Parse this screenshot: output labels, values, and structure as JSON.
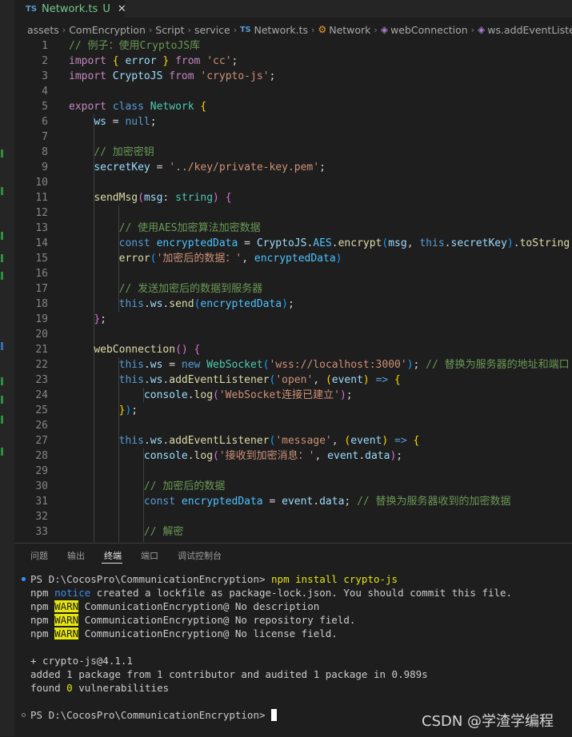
{
  "colors": {
    "comment": "#6a9955",
    "keyword": "#569cd6",
    "control": "#c586c0",
    "string": "#ce9178",
    "type": "#4ec9b0",
    "function": "#dcdcaa",
    "variable": "#9cdcfe",
    "constant": "#4fc1ff",
    "plain": "#d4d4d4",
    "bracket1": "#ffd700",
    "bracket2": "#da70d6",
    "bracket3": "#179fff"
  },
  "tab": {
    "badge": "TS",
    "title": "Network.ts",
    "status": "U",
    "close_icon": "close-icon"
  },
  "breadcrumb": {
    "items": [
      "assets",
      "ComEncryption",
      "Script",
      "service"
    ],
    "file_badge": "TS",
    "file": "Network.ts",
    "class_name": "Network",
    "method1": "webConnection",
    "method2": "ws.addEventListe"
  },
  "code_lines": [
    [
      [
        "// 例子：使用CryptoJS库",
        "comment"
      ]
    ],
    [
      [
        "import",
        "control"
      ],
      [
        " ",
        "plain"
      ],
      [
        "{",
        "bracket1"
      ],
      [
        " ",
        "plain"
      ],
      [
        "error",
        "variable"
      ],
      [
        " ",
        "plain"
      ],
      [
        "}",
        "bracket1"
      ],
      [
        " ",
        "plain"
      ],
      [
        "from",
        "control"
      ],
      [
        " ",
        "plain"
      ],
      [
        "'cc'",
        "string"
      ],
      [
        ";",
        "plain"
      ]
    ],
    [
      [
        "import",
        "control"
      ],
      [
        " ",
        "plain"
      ],
      [
        "CryptoJS",
        "variable"
      ],
      [
        " ",
        "plain"
      ],
      [
        "from",
        "control"
      ],
      [
        " ",
        "plain"
      ],
      [
        "'crypto-js'",
        "string"
      ],
      [
        ";",
        "plain"
      ]
    ],
    [],
    [
      [
        "export",
        "control"
      ],
      [
        " ",
        "plain"
      ],
      [
        "class",
        "keyword"
      ],
      [
        " ",
        "plain"
      ],
      [
        "Network",
        "type"
      ],
      [
        " ",
        "plain"
      ],
      [
        "{",
        "bracket1"
      ]
    ],
    [
      [
        "    ",
        "plain"
      ],
      [
        "ws",
        "variable"
      ],
      [
        " = ",
        "plain"
      ],
      [
        "null",
        "keyword"
      ],
      [
        ";",
        "plain"
      ]
    ],
    [],
    [
      [
        "    ",
        "plain"
      ],
      [
        "// 加密密钥",
        "comment"
      ]
    ],
    [
      [
        "    ",
        "plain"
      ],
      [
        "secretKey",
        "variable"
      ],
      [
        " = ",
        "plain"
      ],
      [
        "'../key/private-key.pem'",
        "string"
      ],
      [
        ";",
        "plain"
      ]
    ],
    [],
    [
      [
        "    ",
        "plain"
      ],
      [
        "sendMsg",
        "function"
      ],
      [
        "(",
        "bracket2"
      ],
      [
        "msg",
        "variable"
      ],
      [
        ": ",
        "plain"
      ],
      [
        "string",
        "type"
      ],
      [
        ")",
        "bracket2"
      ],
      [
        " ",
        "plain"
      ],
      [
        "{",
        "bracket2"
      ]
    ],
    [],
    [
      [
        "        ",
        "plain"
      ],
      [
        "// 使用AES加密算法加密数据",
        "comment"
      ]
    ],
    [
      [
        "        ",
        "plain"
      ],
      [
        "const",
        "keyword"
      ],
      [
        " ",
        "plain"
      ],
      [
        "encryptedData",
        "constant"
      ],
      [
        " = ",
        "plain"
      ],
      [
        "CryptoJS",
        "variable"
      ],
      [
        ".",
        "plain"
      ],
      [
        "AES",
        "constant"
      ],
      [
        ".",
        "plain"
      ],
      [
        "encrypt",
        "function"
      ],
      [
        "(",
        "bracket3"
      ],
      [
        "msg",
        "variable"
      ],
      [
        ", ",
        "plain"
      ],
      [
        "this",
        "keyword"
      ],
      [
        ".",
        "plain"
      ],
      [
        "secretKey",
        "variable"
      ],
      [
        ")",
        "bracket3"
      ],
      [
        ".",
        "plain"
      ],
      [
        "toString",
        "function"
      ],
      [
        "()",
        "bracket3"
      ]
    ],
    [
      [
        "        ",
        "plain"
      ],
      [
        "error",
        "function"
      ],
      [
        "(",
        "bracket3"
      ],
      [
        "'加密后的数据：'",
        "string"
      ],
      [
        ", ",
        "plain"
      ],
      [
        "encryptedData",
        "constant"
      ],
      [
        ")",
        "bracket3"
      ]
    ],
    [],
    [
      [
        "        ",
        "plain"
      ],
      [
        "// 发送加密后的数据到服务器",
        "comment"
      ]
    ],
    [
      [
        "        ",
        "plain"
      ],
      [
        "this",
        "keyword"
      ],
      [
        ".",
        "plain"
      ],
      [
        "ws",
        "variable"
      ],
      [
        ".",
        "plain"
      ],
      [
        "send",
        "function"
      ],
      [
        "(",
        "bracket3"
      ],
      [
        "encryptedData",
        "constant"
      ],
      [
        ")",
        "bracket3"
      ],
      [
        ";",
        "plain"
      ]
    ],
    [
      [
        "    ",
        "plain"
      ],
      [
        "}",
        "bracket2"
      ],
      [
        ";",
        "plain"
      ]
    ],
    [],
    [
      [
        "    ",
        "plain"
      ],
      [
        "webConnection",
        "function"
      ],
      [
        "()",
        "bracket2"
      ],
      [
        " ",
        "plain"
      ],
      [
        "{",
        "bracket2"
      ]
    ],
    [
      [
        "        ",
        "plain"
      ],
      [
        "this",
        "keyword"
      ],
      [
        ".",
        "plain"
      ],
      [
        "ws",
        "variable"
      ],
      [
        " = ",
        "plain"
      ],
      [
        "new",
        "keyword"
      ],
      [
        " ",
        "plain"
      ],
      [
        "WebSocket",
        "type"
      ],
      [
        "(",
        "bracket3"
      ],
      [
        "'wss://localhost:3000'",
        "string"
      ],
      [
        ")",
        "bracket3"
      ],
      [
        "; ",
        "plain"
      ],
      [
        "// 替换为服务器的地址和端口",
        "comment"
      ]
    ],
    [
      [
        "        ",
        "plain"
      ],
      [
        "this",
        "keyword"
      ],
      [
        ".",
        "plain"
      ],
      [
        "ws",
        "variable"
      ],
      [
        ".",
        "plain"
      ],
      [
        "addEventListener",
        "function"
      ],
      [
        "(",
        "bracket3"
      ],
      [
        "'open'",
        "string"
      ],
      [
        ", ",
        "plain"
      ],
      [
        "(",
        "bracket1"
      ],
      [
        "event",
        "variable"
      ],
      [
        ")",
        "bracket1"
      ],
      [
        " ",
        "plain"
      ],
      [
        "=>",
        "keyword"
      ],
      [
        " ",
        "plain"
      ],
      [
        "{",
        "bracket1"
      ]
    ],
    [
      [
        "            ",
        "plain"
      ],
      [
        "console",
        "variable"
      ],
      [
        ".",
        "plain"
      ],
      [
        "log",
        "function"
      ],
      [
        "(",
        "bracket2"
      ],
      [
        "'WebSocket连接已建立'",
        "string"
      ],
      [
        ")",
        "bracket2"
      ],
      [
        ";",
        "plain"
      ]
    ],
    [
      [
        "        ",
        "plain"
      ],
      [
        "}",
        "bracket1"
      ],
      [
        ")",
        "bracket3"
      ],
      [
        ";",
        "plain"
      ]
    ],
    [],
    [
      [
        "        ",
        "plain"
      ],
      [
        "this",
        "keyword"
      ],
      [
        ".",
        "plain"
      ],
      [
        "ws",
        "variable"
      ],
      [
        ".",
        "plain"
      ],
      [
        "addEventListener",
        "function"
      ],
      [
        "(",
        "bracket3"
      ],
      [
        "'message'",
        "string"
      ],
      [
        ", ",
        "plain"
      ],
      [
        "(",
        "bracket1"
      ],
      [
        "event",
        "variable"
      ],
      [
        ")",
        "bracket1"
      ],
      [
        " ",
        "plain"
      ],
      [
        "=>",
        "keyword"
      ],
      [
        " ",
        "plain"
      ],
      [
        "{",
        "bracket1"
      ]
    ],
    [
      [
        "            ",
        "plain"
      ],
      [
        "console",
        "variable"
      ],
      [
        ".",
        "plain"
      ],
      [
        "log",
        "function"
      ],
      [
        "(",
        "bracket2"
      ],
      [
        "'接收到加密消息：'",
        "string"
      ],
      [
        ", ",
        "plain"
      ],
      [
        "event",
        "variable"
      ],
      [
        ".",
        "plain"
      ],
      [
        "data",
        "variable"
      ],
      [
        ")",
        "bracket2"
      ],
      [
        ";",
        "plain"
      ]
    ],
    [],
    [
      [
        "            ",
        "plain"
      ],
      [
        "// 加密后的数据",
        "comment"
      ]
    ],
    [
      [
        "            ",
        "plain"
      ],
      [
        "const",
        "keyword"
      ],
      [
        " ",
        "plain"
      ],
      [
        "encryptedData",
        "constant"
      ],
      [
        " = ",
        "plain"
      ],
      [
        "event",
        "variable"
      ],
      [
        ".",
        "plain"
      ],
      [
        "data",
        "variable"
      ],
      [
        "; ",
        "plain"
      ],
      [
        "// 替换为服务器收到的加密数据",
        "comment"
      ]
    ],
    [],
    [
      [
        "            ",
        "plain"
      ],
      [
        "// 解密",
        "comment"
      ]
    ]
  ],
  "panel": {
    "tabs": [
      "问题",
      "输出",
      "终端",
      "端口",
      "调试控制台"
    ],
    "active_tab": "终端"
  },
  "terminal": {
    "prompt1": "PS D:\\CocosPro\\CommunicationEncryption>",
    "command": "npm install crypto-js",
    "notice_prefix": "npm",
    "notice_word": "notice",
    "notice_text": "created a lockfile as package-lock.json. You should commit this file.",
    "warn_word": "WARN",
    "warn_lines": [
      "CommunicationEncryption@ No description",
      "CommunicationEncryption@ No repository field.",
      "CommunicationEncryption@ No license field."
    ],
    "added_pkg": "+ crypto-js@4.1.1",
    "audit": "added 1 package from 1 contributor and audited 1 package in 0.989s",
    "found_prefix": "found",
    "found_count": "0",
    "found_suffix": "vulnerabilities",
    "prompt2": "PS D:\\CocosPro\\CommunicationEncryption>"
  },
  "watermark": "CSDN @学渣学编程"
}
